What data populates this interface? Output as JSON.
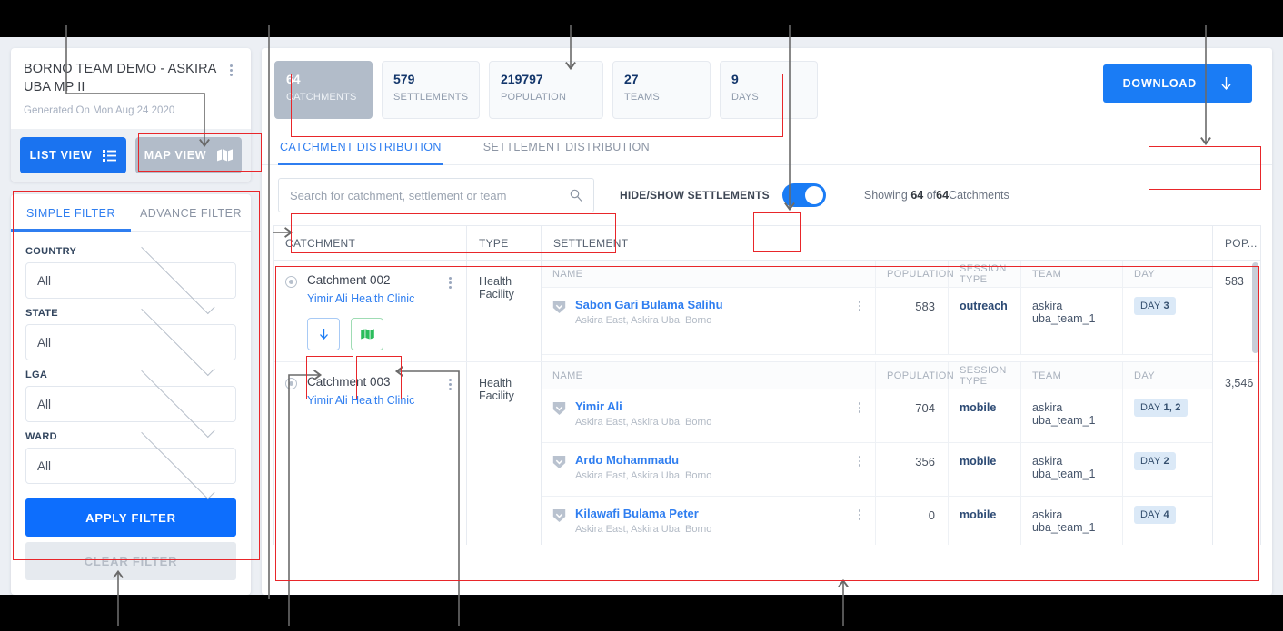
{
  "sidebar": {
    "project": {
      "title": "BORNO TEAM DEMO - ASKIRA UBA MP II",
      "generated": "Generated On Mon Aug 24 2020",
      "kebab_icon": "kebab-menu-icon"
    },
    "views": {
      "list_label": "LIST VIEW",
      "list_icon": "list-icon",
      "map_label": "MAP VIEW",
      "map_icon": "map-icon"
    },
    "filter": {
      "tabs": [
        {
          "label": "SIMPLE FILTER",
          "active": true
        },
        {
          "label": "ADVANCE FILTER",
          "active": false
        }
      ],
      "fields": [
        {
          "label": "COUNTRY",
          "value": "All"
        },
        {
          "label": "STATE",
          "value": "All"
        },
        {
          "label": "LGA",
          "value": "All"
        },
        {
          "label": "WARD",
          "value": "All"
        }
      ],
      "apply_label": "APPLY FILTER",
      "clear_label": "CLEAR FILTER"
    }
  },
  "main": {
    "stats": [
      {
        "num": "64",
        "label": "CATCHMENTS",
        "selected": true
      },
      {
        "num": "579",
        "label": "SETTLEMENTS",
        "selected": false
      },
      {
        "num": "219797",
        "label": "POPULATION",
        "selected": false
      },
      {
        "num": "27",
        "label": "TEAMS",
        "selected": false
      },
      {
        "num": "9",
        "label": "DAYS",
        "selected": false
      }
    ],
    "tabs": [
      {
        "label": "CATCHMENT DISTRIBUTION",
        "active": true
      },
      {
        "label": "SETTLEMENT DISTRIBUTION",
        "active": false
      }
    ],
    "download_label": "DOWNLOAD",
    "download_icon": "download-arrow-icon",
    "search": {
      "placeholder": "Search for catchment, settlement or team",
      "value": "",
      "icon": "search-icon"
    },
    "toggle": {
      "label": "HIDE/SHOW SETTLEMENTS",
      "on": true
    },
    "showing": {
      "prefix": "Showing",
      "count": "64",
      "mid": "of",
      "total": "64",
      "suffix": "Catchments"
    },
    "table": {
      "headers": {
        "catchment": "CATCHMENT",
        "type": "TYPE",
        "settlement": "SETTLEMENT",
        "pop": "POP..."
      },
      "sub_headers": {
        "name": "NAME",
        "population": "POPULATION",
        "session_type": "SESSION TYPE",
        "team": "TEAM",
        "day": "DAY"
      },
      "groups": [
        {
          "catchment": "Catchment 002",
          "clinic": "Yimir Ali Health Clinic",
          "type": "Health Facility",
          "total_pop": "583",
          "show_actions": true,
          "actions": {
            "download_icon": "download-arrow-icon",
            "map_icon": "map-icon"
          },
          "settlements": [
            {
              "name": "Sabon Gari Bulama Salihu",
              "address": "Askira East, Askira Uba, Borno",
              "population": "583",
              "session_type": "outreach",
              "team": "askira uba_team_1",
              "day_label": "DAY",
              "day_value": "3"
            }
          ]
        },
        {
          "catchment": "Catchment 003",
          "clinic": "Yimir Ali Health Clinic",
          "type": "Health Facility",
          "total_pop": "3,546",
          "show_actions": false,
          "actions": {
            "download_icon": "download-arrow-icon",
            "map_icon": "map-icon"
          },
          "settlements": [
            {
              "name": "Yimir Ali",
              "address": "Askira East, Askira Uba, Borno",
              "population": "704",
              "session_type": "mobile",
              "team": "askira uba_team_1",
              "day_label": "DAY",
              "day_value": "1, 2"
            },
            {
              "name": "Ardo Mohammadu",
              "address": "Askira East, Askira Uba, Borno",
              "population": "356",
              "session_type": "mobile",
              "team": "askira uba_team_1",
              "day_label": "DAY",
              "day_value": "2"
            },
            {
              "name": "Kilawafi Bulama Peter",
              "address": "Askira East, Askira Uba, Borno",
              "population": "0",
              "session_type": "mobile",
              "team": "askira uba_team_1",
              "day_label": "DAY",
              "day_value": "4"
            }
          ]
        }
      ]
    }
  },
  "colors": {
    "accent": "#1a7cf5",
    "annotation": "#e8262a",
    "muted_button": "#b2bcc9",
    "green": "#2bbd5c"
  }
}
